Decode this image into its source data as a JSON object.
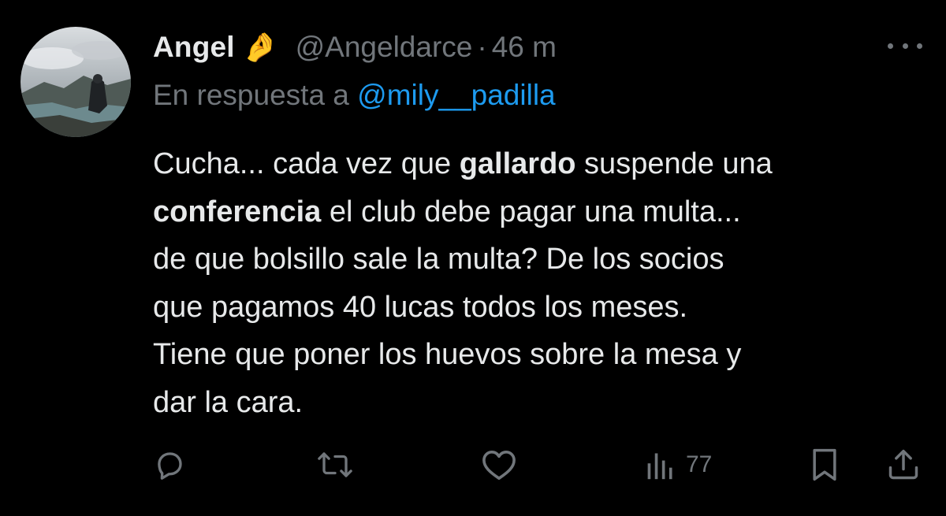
{
  "user": {
    "display_name": "Angel",
    "emoji": "🤌",
    "handle": "@Angeldarce",
    "separator": "·",
    "time": "46 m"
  },
  "reply": {
    "prefix": "En respuesta a",
    "mention": "@mily__padilla"
  },
  "tweet": {
    "line1_pre": "Cucha... cada vez que ",
    "line1_bold": "gallardo",
    "line1_post": " suspende una",
    "line2_bold": "conferencia",
    "line2_post": " el club debe pagar una multa...",
    "line3": "de que bolsillo sale la multa? De los socios",
    "line4": "que pagamos 40 lucas todos los meses.",
    "line5": "Tiene que poner los huevos sobre la mesa y",
    "line6": "dar la cara."
  },
  "actions": {
    "views": "77",
    "icons": [
      "reply-icon",
      "retweet-icon",
      "like-icon",
      "views-icon",
      "bookmark-icon",
      "share-icon"
    ]
  },
  "colors": {
    "background": "#000000",
    "text": "#e7e9ea",
    "secondary": "#71767b",
    "link": "#1d9bf0"
  }
}
